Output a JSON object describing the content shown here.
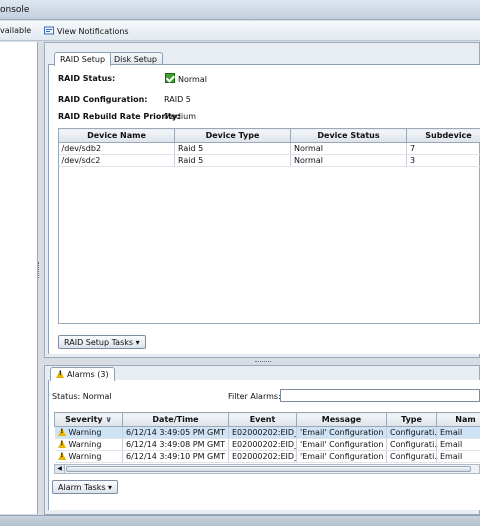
{
  "window": {
    "title": "onsole"
  },
  "toolbar": {
    "available_label": "vailable",
    "notifications_label": "View Notifications"
  },
  "raid_tabs": [
    {
      "label": "RAID Setup",
      "active": true
    },
    {
      "label": "Disk Setup",
      "active": false
    }
  ],
  "raid": {
    "status_label": "RAID Status:",
    "status_value": "Normal",
    "config_label": "RAID Configuration:",
    "config_value": "RAID 5",
    "priority_label": "RAID Rebuild Rate Priority:",
    "priority_value": "Medium",
    "columns": [
      "Device Name",
      "Device Type",
      "Device Status",
      "Subdevice"
    ],
    "rows": [
      [
        "/dev/sdb2",
        "Raid 5",
        "Normal",
        "7"
      ],
      [
        "/dev/sdc2",
        "Raid 5",
        "Normal",
        "3"
      ]
    ],
    "tasks_button": "RAID Setup Tasks ▾"
  },
  "alarms": {
    "tab_label": "Alarms (3)",
    "status_text": "Status:  Normal",
    "filter_label": "Filter Alarms:",
    "filter_value": "",
    "columns": [
      "Severity",
      "Date/Time",
      "Event",
      "Message",
      "Type",
      "Nam"
    ],
    "rows": [
      [
        "Warning",
        "6/12/14 3:49:05 PM GMT",
        "E02000202:EID_...",
        "'Email' Configuration S...",
        "Configurati...",
        "Email"
      ],
      [
        "Warning",
        "6/12/14 3:49:08 PM GMT",
        "E02000202:EID_...",
        "'Email' Configuration S...",
        "Configurati...",
        "Email"
      ],
      [
        "Warning",
        "6/12/14 3:49:10 PM GMT",
        "E02000202:EID_...",
        "'Email' Configuration S...",
        "Configurati...",
        "Email"
      ]
    ],
    "tasks_button": "Alarm Tasks ▾"
  },
  "colors": {
    "accent": "#cfe3f7",
    "ok": "#3ea035",
    "warning": "#e8b400"
  }
}
